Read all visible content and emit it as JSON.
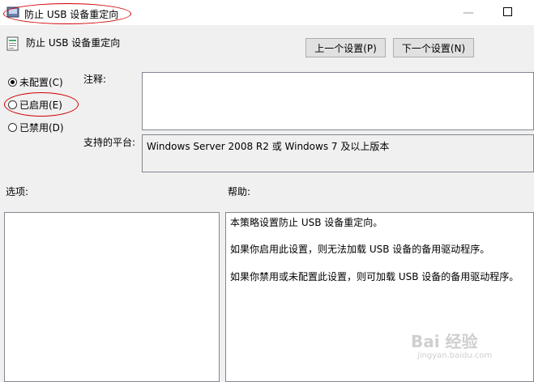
{
  "window": {
    "title": "防止 USB 设备重定向",
    "close_glyph": "□",
    "minimize_glyph": "—"
  },
  "header": {
    "title": "防止 USB 设备重定向"
  },
  "nav": {
    "prev_label": "上一个设置(P)",
    "next_label": "下一个设置(N)"
  },
  "radios": [
    {
      "label": "未配置(C)",
      "checked": true
    },
    {
      "label": "已启用(E)",
      "checked": false
    },
    {
      "label": "已禁用(D)",
      "checked": false
    }
  ],
  "comment": {
    "label": "注释:",
    "value": ""
  },
  "platform": {
    "label": "支持的平台:",
    "value": "Windows Server 2008 R2 或 Windows 7 及以上版本"
  },
  "options": {
    "label": "选项:"
  },
  "help": {
    "label": "帮助:",
    "lines": [
      "本策略设置防止 USB 设备重定向。",
      "如果你启用此设置，则无法加载 USB 设备的备用驱动程序。",
      "如果你禁用或未配置此设置，则可加载 USB 设备的备用驱动程序。"
    ]
  },
  "watermark": {
    "logo": "Bai 经验",
    "url": "jingyan.baidu.com"
  },
  "colors": {
    "annotation": "#d00000"
  }
}
